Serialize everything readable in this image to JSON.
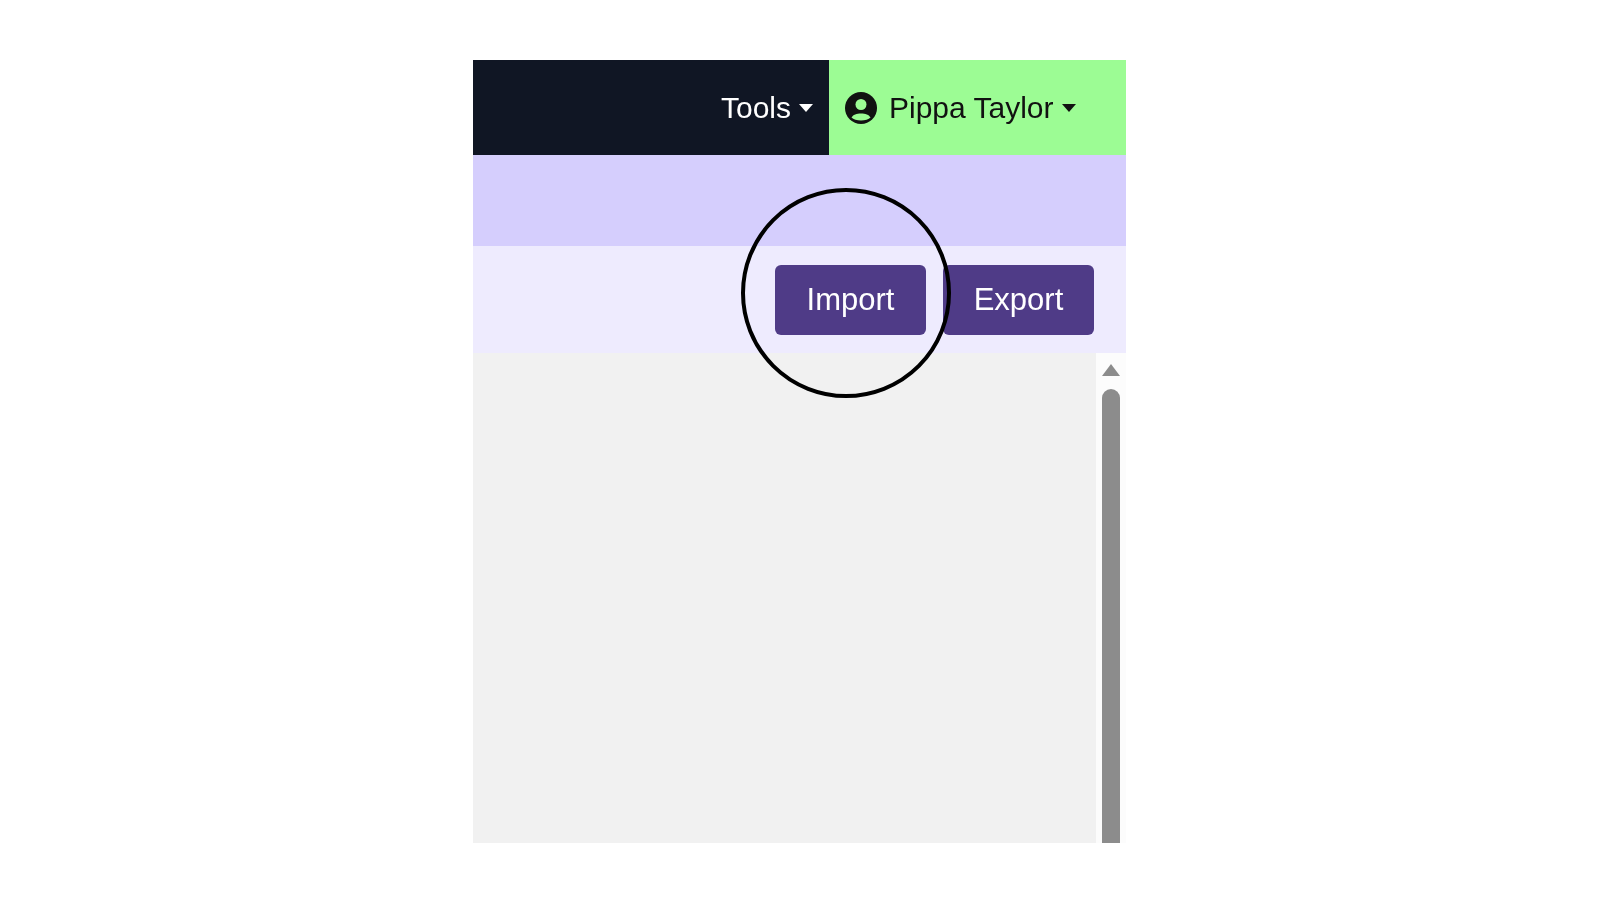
{
  "navbar": {
    "tools_menu": {
      "label": "Tools"
    },
    "user_menu": {
      "label": "Pippa Taylor"
    }
  },
  "toolbar": {
    "buttons": [
      {
        "label": "Import"
      },
      {
        "label": "Export"
      }
    ]
  },
  "annotation": {
    "kind": "circle"
  }
}
